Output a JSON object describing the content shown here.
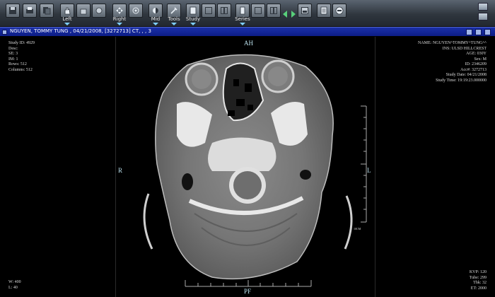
{
  "toolbar": {
    "labels": {
      "left": "Left",
      "right": "Right",
      "mid": "Mid",
      "tools": "Tools",
      "study": "Study",
      "series": "Series"
    },
    "icons": [
      "save-icon",
      "print-icon",
      "export-icon",
      "hand-pan-icon",
      "hand-grab-icon",
      "hand-point-icon",
      "move-icon",
      "target-icon",
      "window-level-icon",
      "tools-icon",
      "study-icon",
      "layout-single-icon",
      "layout-double-icon",
      "series-icon",
      "series-single-icon",
      "series-double-icon",
      "prev-next-icon",
      "key-image-icon",
      "report-icon",
      "stop-icon"
    ]
  },
  "patient_bar": {
    "title": "NGUYEN, TOMMY TUNG , 04/21/2008, [3272713] CT, , , 3"
  },
  "overlays": {
    "top_left": {
      "study_id": "Study ID: 4929",
      "desc": "Desc:",
      "se": "SE: 3",
      "im": "IM: 1",
      "rows": "Rows: 512",
      "columns": "Columns: 512"
    },
    "top_right": {
      "name": "NAME: NGUYEN^TOMMY^TUNG^^",
      "inst": "INS: ULSD HILLCREST",
      "age": "AGE: 030Y",
      "sex": "Sex: M",
      "id": "ID: 2346209",
      "acc": "Acc#: 3272713",
      "study_date": "Study Date: 04/21/2008",
      "study_time": "Study Time: 19:19:23.000000"
    },
    "bottom_left": {
      "w": "W: 400",
      "l": "L: 40"
    },
    "bottom_right": {
      "kvp": "KVP: 120",
      "tube": "Tube: 299",
      "thk": "Thk: 32",
      "et": "ET: 2000"
    },
    "orientation": {
      "top": "AH",
      "bottom": "PF",
      "left": "R",
      "right": "L"
    },
    "scale_label": "10CM"
  },
  "colors": {
    "toolbar": "#2f363e",
    "patient_bar": "#0c1d86",
    "orientation": "#bde3f0",
    "overlay_text": "#dcdcdc"
  }
}
